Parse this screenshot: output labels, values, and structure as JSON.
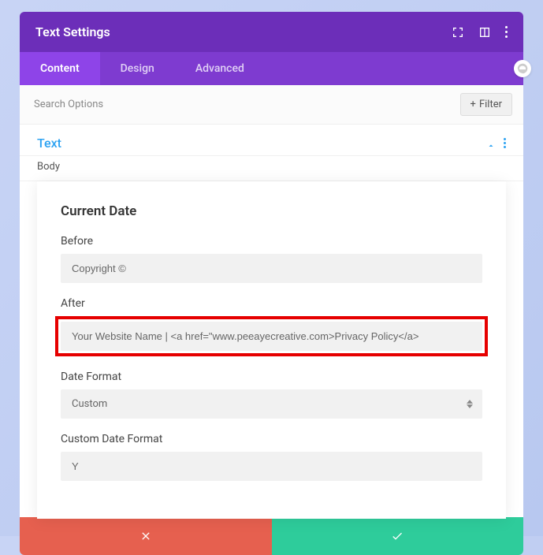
{
  "header": {
    "title": "Text Settings"
  },
  "tabs": {
    "content": "Content",
    "design": "Design",
    "advanced": "Advanced"
  },
  "search": {
    "placeholder": "Search Options",
    "filter_label": "Filter"
  },
  "section": {
    "title": "Text",
    "body_label": "Body"
  },
  "panel": {
    "title": "Current Date",
    "fields": {
      "before": {
        "label": "Before",
        "value": "Copyright ©"
      },
      "after": {
        "label": "After",
        "value": "Your Website Name | <a href=\"www.peeayecreative.com>Privacy Policy</a>"
      },
      "date_format": {
        "label": "Date Format",
        "value": "Custom"
      },
      "custom_date_format": {
        "label": "Custom Date Format",
        "value": "Y"
      }
    }
  }
}
